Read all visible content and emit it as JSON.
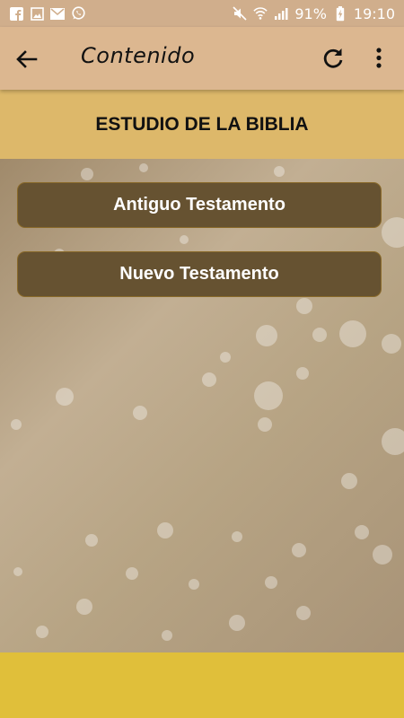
{
  "status_bar": {
    "battery_percent": "91%",
    "time": "19:10",
    "left_icons": [
      "facebook-icon",
      "gallery-icon",
      "email-icon",
      "whatsapp-icon"
    ],
    "right_icons": [
      "mute-icon",
      "wifi-icon",
      "signal-icon",
      "battery-charging-icon"
    ]
  },
  "app_bar": {
    "title": "Contenido",
    "icons": [
      "back-arrow-icon",
      "refresh-icon",
      "more-vert-icon"
    ]
  },
  "header": {
    "title": "ESTUDIO DE LA BIBLIA"
  },
  "menu": {
    "items": [
      {
        "label": "Antiguo Testamento"
      },
      {
        "label": "Nuevo Testamento"
      }
    ]
  },
  "colors": {
    "status_bar": "#d0ae8c",
    "app_bar": "#dcb790",
    "header_band": "#ddb86a",
    "button": "#665231",
    "footer": "#e0bf3a"
  }
}
